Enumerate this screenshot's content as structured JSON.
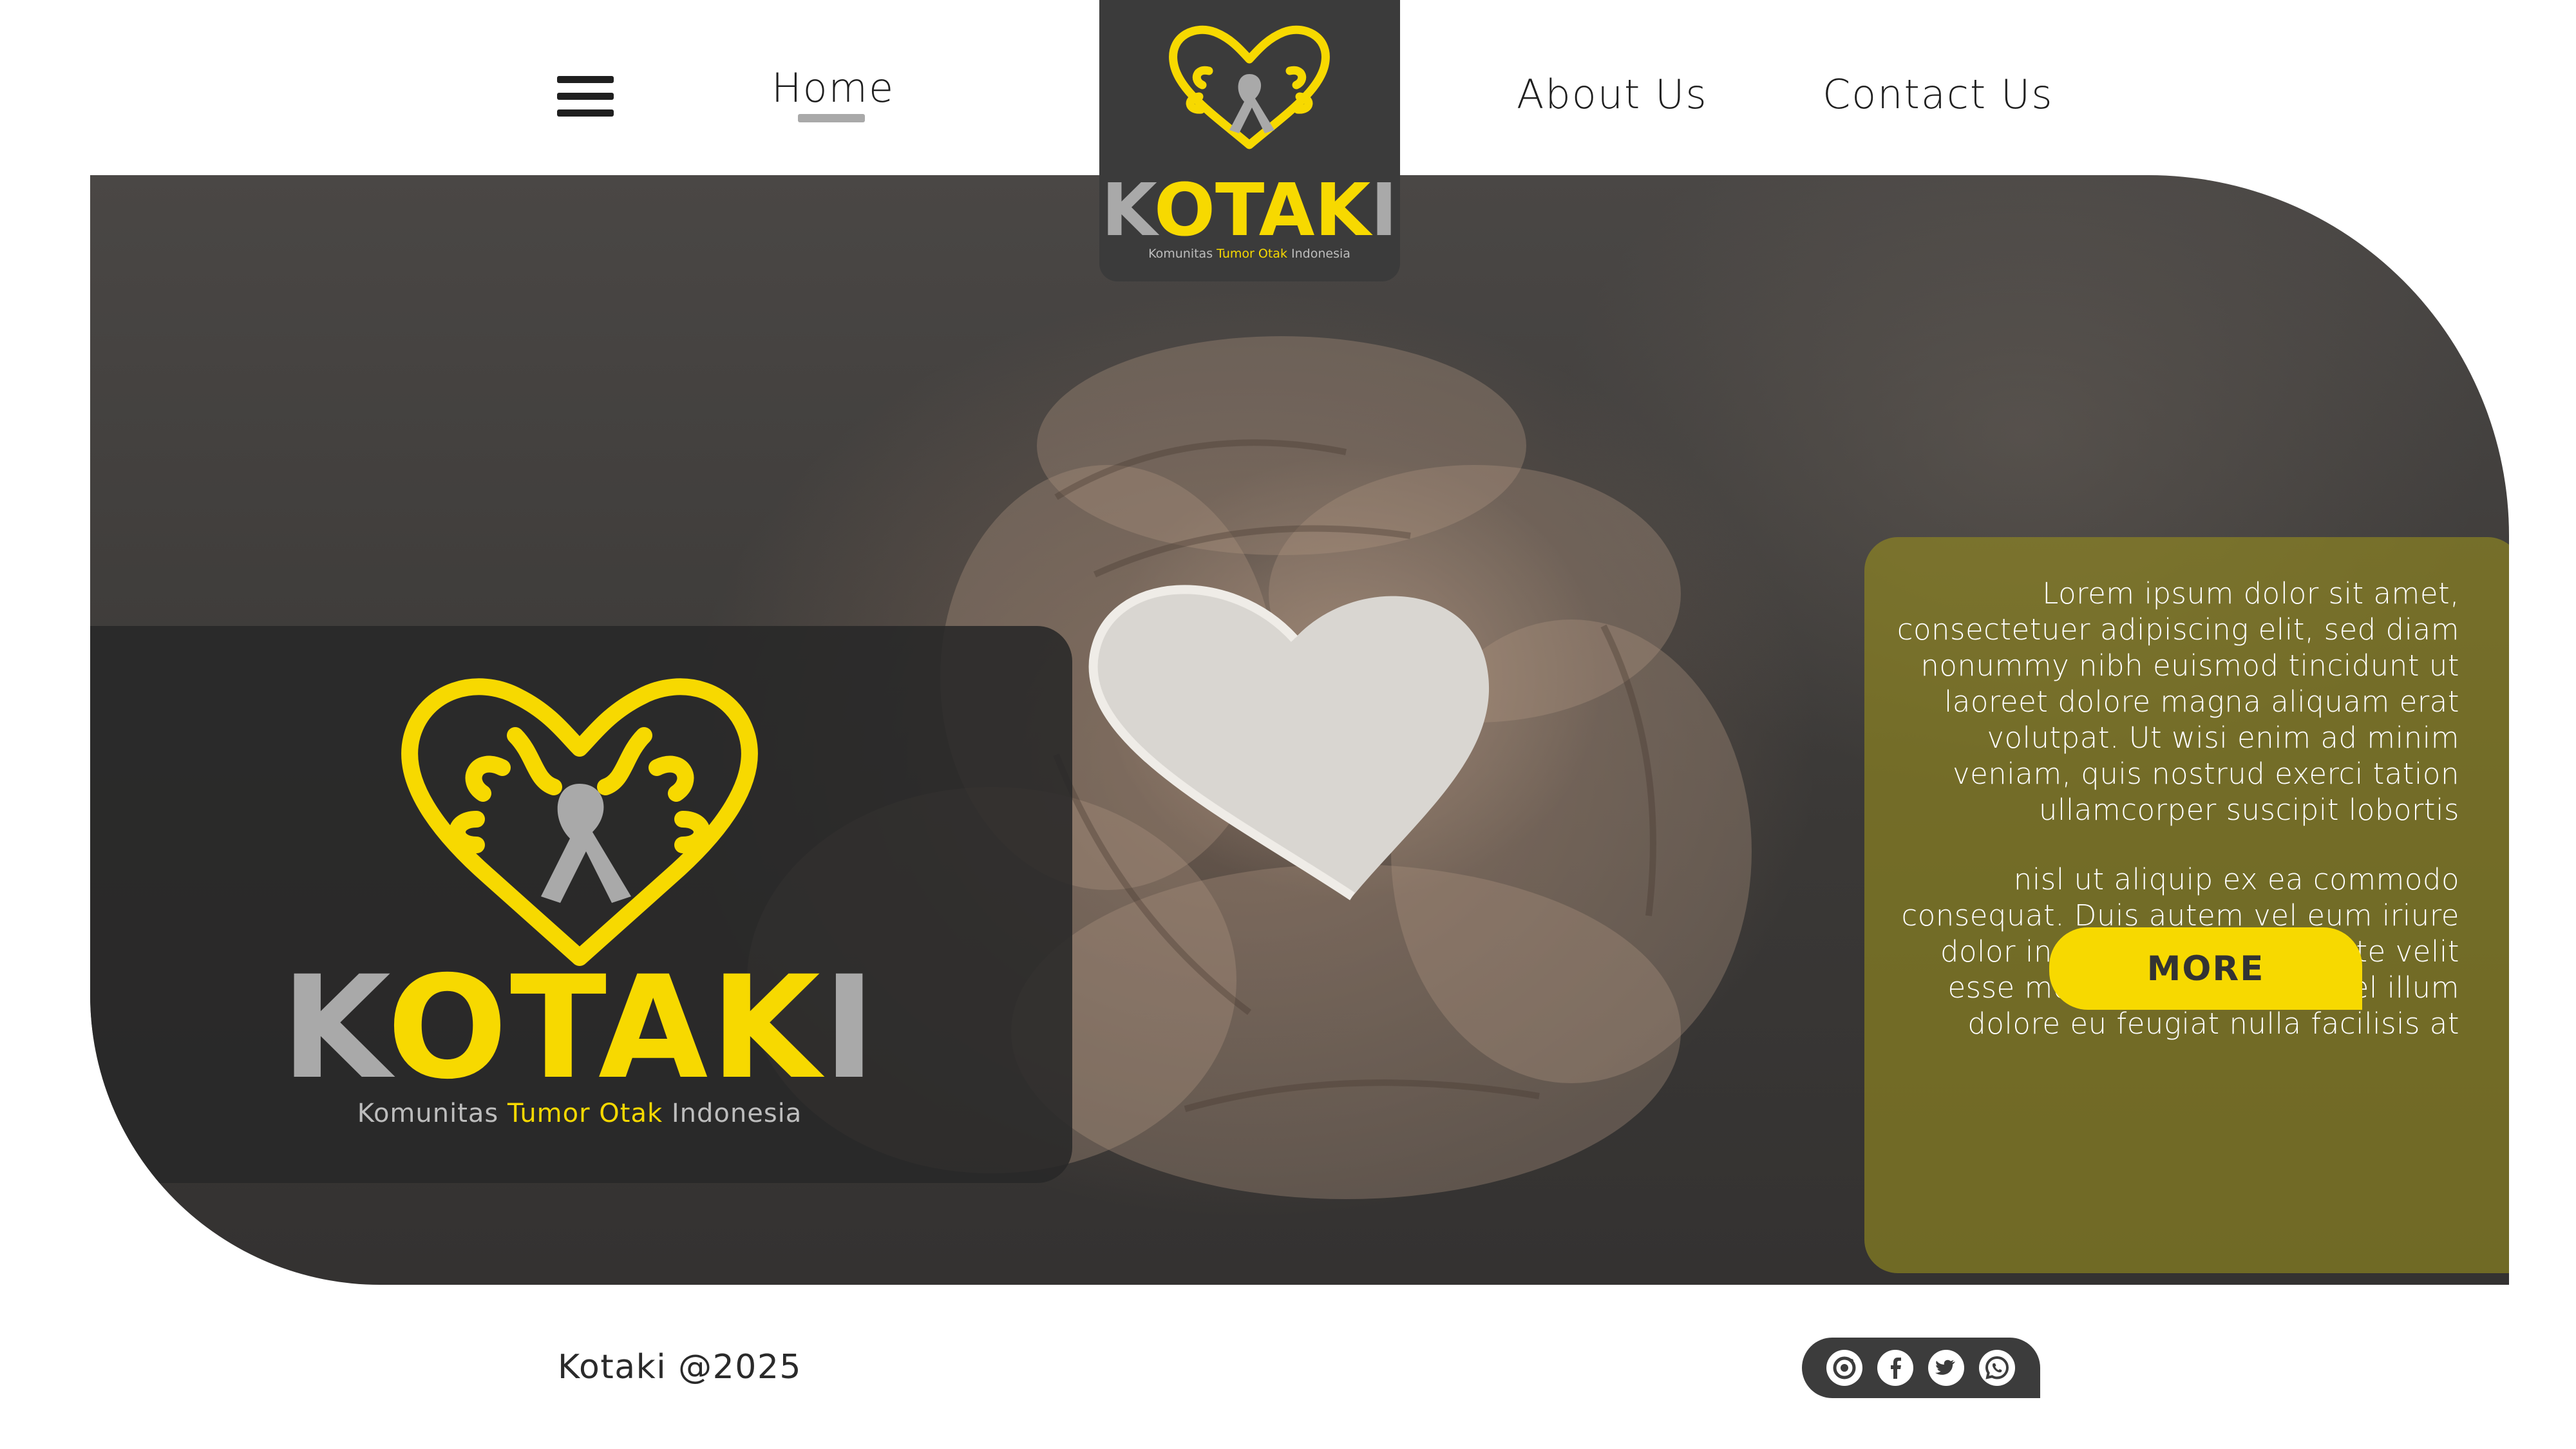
{
  "nav": {
    "home": "Home",
    "about": "About Us",
    "contact": "Contact Us"
  },
  "brand": {
    "name_gray_1": "K",
    "name_yellow": "OTAK",
    "name_gray_2": "I",
    "tagline_1": "Komunitas",
    "tagline_highlight": "Tumor Otak",
    "tagline_2": "Indonesia"
  },
  "hero": {
    "paragraph_1": "Lorem ipsum dolor sit amet, consectetuer adipiscing elit, sed diam nonummy nibh euismod tincidunt ut laoreet dolore magna aliquam erat volutpat. Ut wisi enim ad minim veniam, quis nostrud exerci tation ullamcorper suscipit lobortis",
    "paragraph_2": "nisl ut aliquip ex ea commodo consequat. Duis autem vel eum iriure dolor in hendrerit in vulputate velit esse molestie consequat, vel illum dolore eu feugiat nulla facilisis at",
    "more_button": "MORE"
  },
  "footer": {
    "copyright": "Kotaki @2025",
    "social_icons": [
      "instagram-icon",
      "facebook-icon",
      "twitter-icon",
      "whatsapp-icon"
    ]
  },
  "colors": {
    "brand_yellow": "#f7d900",
    "brand_gray": "#a9a9a9",
    "dark": "#3b3b3b"
  }
}
